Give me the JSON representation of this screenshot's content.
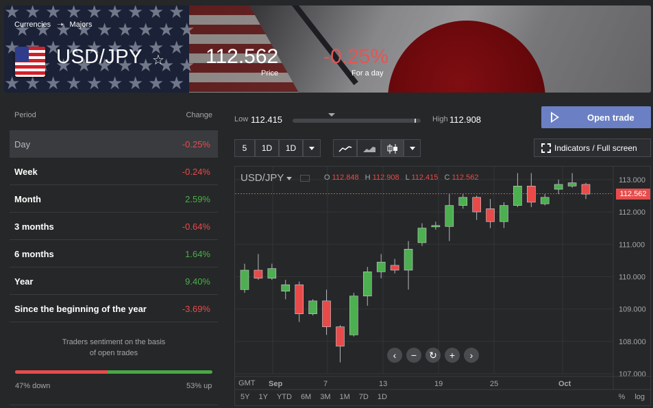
{
  "breadcrumb": {
    "items": [
      "Currencies",
      "Majors"
    ]
  },
  "instrument": {
    "pair": "USD/JPY",
    "star": "☆",
    "price": "112.562",
    "price_label": "Price",
    "change": "-0.25%",
    "change_label": "For a day"
  },
  "periods": {
    "header_period": "Period",
    "header_change": "Change",
    "rows": [
      {
        "label": "Day",
        "value": "-0.25%",
        "trend": "neg",
        "selected": true
      },
      {
        "label": "Week",
        "value": "-0.24%",
        "trend": "neg"
      },
      {
        "label": "Month",
        "value": "2.59%",
        "trend": "pos"
      },
      {
        "label": "3 months",
        "value": "-0.64%",
        "trend": "neg"
      },
      {
        "label": "6 months",
        "value": "1.64%",
        "trend": "pos"
      },
      {
        "label": "Year",
        "value": "9.40%",
        "trend": "pos"
      },
      {
        "label": "Since the beginning of the year",
        "value": "-3.69%",
        "trend": "neg"
      }
    ]
  },
  "sentiment": {
    "text_line1": "Traders sentiment on the basis",
    "text_line2": "of open trades",
    "down_pct": 47,
    "down_label": "47% down",
    "up_label": "53% up"
  },
  "range": {
    "low_label": "Low",
    "low": "112.415",
    "high_label": "High",
    "high": "112.908",
    "position": 0.95
  },
  "open_trade_label": "Open trade",
  "toolbar": {
    "interval": "5",
    "period1": "1D",
    "period2": "1D",
    "indicators_label": "Indicators / Full screen"
  },
  "chart": {
    "symbol": "USD/JPY",
    "ohlc": {
      "o_label": "O",
      "o": "112.848",
      "h_label": "H",
      "h": "112.908",
      "l_label": "L",
      "l": "112.415",
      "c_label": "C",
      "c": "112.562"
    },
    "last_price": "112.562",
    "gmt": "GMT",
    "timeframes": [
      "5Y",
      "1Y",
      "YTD",
      "6M",
      "3M",
      "1M",
      "7D",
      "1D"
    ],
    "scale_options": [
      "%",
      "log"
    ]
  },
  "chart_data": {
    "type": "candlestick",
    "ylim": [
      107.0,
      113.4
    ],
    "y_ticks": [
      "113.000",
      "112.000",
      "111.000",
      "110.000",
      "109.000",
      "108.000",
      "107.000"
    ],
    "x_ticks": [
      "Sep",
      "7",
      "13",
      "19",
      "25",
      "Oct"
    ],
    "candles": [
      {
        "o": 109.6,
        "h": 110.4,
        "l": 109.5,
        "c": 110.2
      },
      {
        "o": 110.2,
        "h": 110.7,
        "l": 109.9,
        "c": 109.95
      },
      {
        "o": 109.95,
        "h": 110.4,
        "l": 109.9,
        "c": 110.25
      },
      {
        "o": 109.55,
        "h": 109.9,
        "l": 109.3,
        "c": 109.75
      },
      {
        "o": 109.75,
        "h": 109.85,
        "l": 108.6,
        "c": 108.85
      },
      {
        "o": 108.85,
        "h": 109.3,
        "l": 108.8,
        "c": 109.25
      },
      {
        "o": 109.25,
        "h": 109.6,
        "l": 108.2,
        "c": 108.45
      },
      {
        "o": 108.45,
        "h": 108.5,
        "l": 107.35,
        "c": 107.85
      },
      {
        "o": 108.2,
        "h": 109.5,
        "l": 108.15,
        "c": 109.4
      },
      {
        "o": 109.4,
        "h": 110.3,
        "l": 109.1,
        "c": 110.15
      },
      {
        "o": 110.15,
        "h": 110.7,
        "l": 109.95,
        "c": 110.45
      },
      {
        "o": 110.35,
        "h": 110.55,
        "l": 110.1,
        "c": 110.2
      },
      {
        "o": 110.2,
        "h": 111.1,
        "l": 109.6,
        "c": 110.85
      },
      {
        "o": 111.05,
        "h": 111.65,
        "l": 110.95,
        "c": 111.5
      },
      {
        "o": 111.55,
        "h": 111.7,
        "l": 111.45,
        "c": 111.58
      },
      {
        "o": 111.55,
        "h": 112.55,
        "l": 111.1,
        "c": 112.2
      },
      {
        "o": 112.2,
        "h": 112.55,
        "l": 112.1,
        "c": 112.45
      },
      {
        "o": 112.45,
        "h": 112.5,
        "l": 111.75,
        "c": 112.0
      },
      {
        "o": 112.1,
        "h": 112.4,
        "l": 111.5,
        "c": 111.7
      },
      {
        "o": 111.7,
        "h": 112.3,
        "l": 111.5,
        "c": 112.2
      },
      {
        "o": 112.2,
        "h": 113.2,
        "l": 112.15,
        "c": 112.8
      },
      {
        "o": 112.8,
        "h": 113.2,
        "l": 112.15,
        "c": 112.3
      },
      {
        "o": 112.25,
        "h": 112.55,
        "l": 112.2,
        "c": 112.45
      },
      {
        "o": 112.7,
        "h": 113.0,
        "l": 112.55,
        "c": 112.85
      },
      {
        "o": 112.8,
        "h": 113.2,
        "l": 112.75,
        "c": 112.9
      },
      {
        "o": 112.85,
        "h": 112.9,
        "l": 112.4,
        "c": 112.55
      }
    ]
  }
}
